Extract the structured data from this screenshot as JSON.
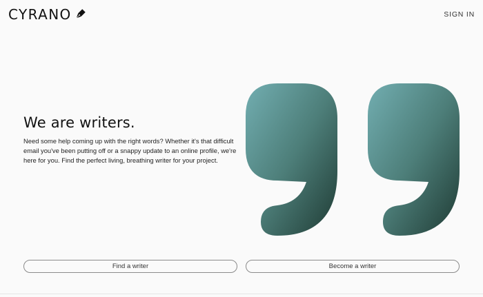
{
  "header": {
    "logo_text": "CYRANO",
    "logo_icon": "fountain-pen-nib-icon",
    "signin_label": "SIGN IN"
  },
  "hero": {
    "title": "We are writers.",
    "description": "Need some help coming up with the right words? Whether it's that difficult email you've been putting off or a snappy update to an online profile, we're here for you. Find the perfect living, breathing writer for your project.",
    "illustration": "double-quote-marks",
    "colors": {
      "gradient_start": "#72aeb1",
      "gradient_mid": "#4d7e79",
      "gradient_end": "#1f3b34"
    }
  },
  "actions": {
    "find_label": "Find a writer",
    "become_label": "Become a writer"
  }
}
